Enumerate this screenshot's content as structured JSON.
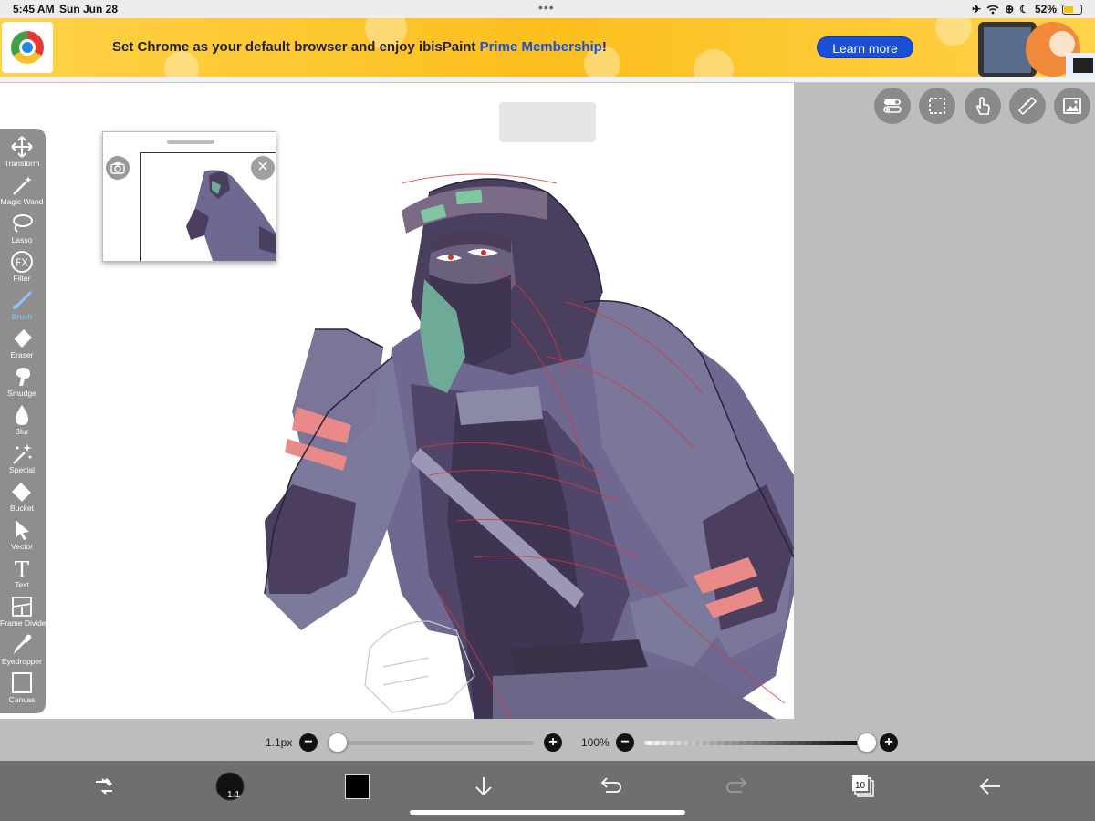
{
  "status_bar": {
    "time": "5:45 AM",
    "date": "Sun Jun 28",
    "battery": "52%"
  },
  "banner": {
    "text_prefix": "Set Chrome as your default browser and enjoy ibisPaint ",
    "text_highlight": "Prime Membership",
    "text_suffix": "!",
    "button": "Learn more",
    "highlight_color": "#1d4fd1",
    "button_color": "#1a4fd6"
  },
  "top_right_buttons": [
    {
      "icon": "toggle-icon"
    },
    {
      "icon": "selection-icon"
    },
    {
      "icon": "hand-touch-icon"
    },
    {
      "icon": "ruler-icon"
    },
    {
      "icon": "image-icon"
    }
  ],
  "toolbar": {
    "active": "Brush",
    "accent_color": "#8ec5ff",
    "tools": [
      {
        "label": "Transform",
        "icon": "move-arrows-icon"
      },
      {
        "label": "Magic Wand",
        "icon": "magic-wand-icon"
      },
      {
        "label": "Lasso",
        "icon": "lasso-icon"
      },
      {
        "label": "Filter",
        "icon": "fx-icon"
      },
      {
        "label": "Brush",
        "icon": "brush-icon"
      },
      {
        "label": "Eraser",
        "icon": "eraser-icon"
      },
      {
        "label": "Smudge",
        "icon": "smudge-icon"
      },
      {
        "label": "Blur",
        "icon": "drop-icon"
      },
      {
        "label": "Special",
        "icon": "sparkle-icon"
      },
      {
        "label": "Bucket",
        "icon": "bucket-icon"
      },
      {
        "label": "Vector",
        "icon": "cursor-icon"
      },
      {
        "label": "Text",
        "icon": "text-icon"
      },
      {
        "label": "Frame Divider",
        "icon": "frame-divider-icon"
      },
      {
        "label": "Eyedropper",
        "icon": "eyedropper-icon"
      },
      {
        "label": "Canvas",
        "icon": "canvas-icon"
      }
    ]
  },
  "sliders": {
    "brush_size": {
      "label": "1.1px",
      "value": 0.02
    },
    "opacity": {
      "label": "100%",
      "value": 1.0
    }
  },
  "bottom_bar": {
    "brush_size_badge": "1.1",
    "layer_count": "10",
    "current_color": "#000000",
    "icons": [
      "swap-icon",
      "brush-size-icon",
      "color-swatch-icon",
      "download-icon",
      "undo-icon",
      "redo-icon",
      "layers-icon",
      "back-arrow-icon"
    ]
  }
}
